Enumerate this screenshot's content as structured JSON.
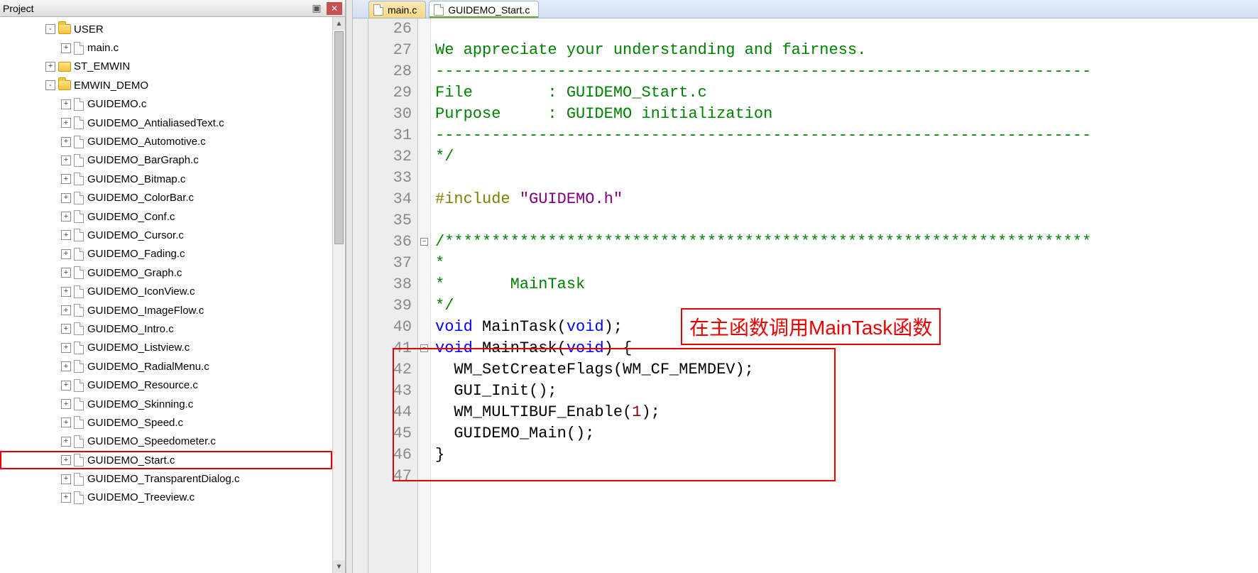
{
  "project_panel": {
    "title": "Project",
    "tree": [
      {
        "depth": 2,
        "exp": "-",
        "kind": "folder-open",
        "label": "USER"
      },
      {
        "depth": 3,
        "exp": "+",
        "kind": "file",
        "label": "main.c"
      },
      {
        "depth": 2,
        "exp": "+",
        "kind": "folder",
        "label": "ST_EMWIN"
      },
      {
        "depth": 2,
        "exp": "-",
        "kind": "folder-open",
        "label": "EMWIN_DEMO"
      },
      {
        "depth": 3,
        "exp": "+",
        "kind": "file",
        "label": "GUIDEMO.c"
      },
      {
        "depth": 3,
        "exp": "+",
        "kind": "file",
        "label": "GUIDEMO_AntialiasedText.c"
      },
      {
        "depth": 3,
        "exp": "+",
        "kind": "file",
        "label": "GUIDEMO_Automotive.c"
      },
      {
        "depth": 3,
        "exp": "+",
        "kind": "file",
        "label": "GUIDEMO_BarGraph.c"
      },
      {
        "depth": 3,
        "exp": "+",
        "kind": "file",
        "label": "GUIDEMO_Bitmap.c"
      },
      {
        "depth": 3,
        "exp": "+",
        "kind": "file",
        "label": "GUIDEMO_ColorBar.c"
      },
      {
        "depth": 3,
        "exp": "+",
        "kind": "file",
        "label": "GUIDEMO_Conf.c"
      },
      {
        "depth": 3,
        "exp": "+",
        "kind": "file",
        "label": "GUIDEMO_Cursor.c"
      },
      {
        "depth": 3,
        "exp": "+",
        "kind": "file",
        "label": "GUIDEMO_Fading.c"
      },
      {
        "depth": 3,
        "exp": "+",
        "kind": "file",
        "label": "GUIDEMO_Graph.c"
      },
      {
        "depth": 3,
        "exp": "+",
        "kind": "file",
        "label": "GUIDEMO_IconView.c"
      },
      {
        "depth": 3,
        "exp": "+",
        "kind": "file",
        "label": "GUIDEMO_ImageFlow.c"
      },
      {
        "depth": 3,
        "exp": "+",
        "kind": "file",
        "label": "GUIDEMO_Intro.c"
      },
      {
        "depth": 3,
        "exp": "+",
        "kind": "file",
        "label": "GUIDEMO_Listview.c"
      },
      {
        "depth": 3,
        "exp": "+",
        "kind": "file",
        "label": "GUIDEMO_RadialMenu.c"
      },
      {
        "depth": 3,
        "exp": "+",
        "kind": "file",
        "label": "GUIDEMO_Resource.c"
      },
      {
        "depth": 3,
        "exp": "+",
        "kind": "file",
        "label": "GUIDEMO_Skinning.c"
      },
      {
        "depth": 3,
        "exp": "+",
        "kind": "file",
        "label": "GUIDEMO_Speed.c"
      },
      {
        "depth": 3,
        "exp": "+",
        "kind": "file",
        "label": "GUIDEMO_Speedometer.c"
      },
      {
        "depth": 3,
        "exp": "+",
        "kind": "file",
        "label": "GUIDEMO_Start.c",
        "highlight": true
      },
      {
        "depth": 3,
        "exp": "+",
        "kind": "file",
        "label": "GUIDEMO_TransparentDialog.c"
      },
      {
        "depth": 3,
        "exp": "+",
        "kind": "file",
        "label": "GUIDEMO_Treeview.c"
      }
    ]
  },
  "editor": {
    "tabs": [
      {
        "label": "main.c",
        "active": false
      },
      {
        "label": "GUIDEMO_Start.c",
        "active": true
      }
    ],
    "first_line_no": 26,
    "lines": [
      {
        "fold": "",
        "tokens": []
      },
      {
        "fold": "",
        "tokens": [
          {
            "cls": "c-comment",
            "t": "We appreciate your understanding and fairness."
          }
        ]
      },
      {
        "fold": "",
        "tokens": [
          {
            "cls": "c-comment",
            "t": "----------------------------------------------------------------------"
          }
        ]
      },
      {
        "fold": "",
        "tokens": [
          {
            "cls": "c-comment",
            "t": "File        : GUIDEMO_Start.c"
          }
        ]
      },
      {
        "fold": "",
        "tokens": [
          {
            "cls": "c-comment",
            "t": "Purpose     : GUIDEMO initialization"
          }
        ]
      },
      {
        "fold": "",
        "tokens": [
          {
            "cls": "c-comment",
            "t": "----------------------------------------------------------------------"
          }
        ]
      },
      {
        "fold": "",
        "tokens": [
          {
            "cls": "c-comment",
            "t": "*/"
          }
        ]
      },
      {
        "fold": "",
        "tokens": []
      },
      {
        "fold": "",
        "tokens": [
          {
            "cls": "c-pp",
            "t": "#include "
          },
          {
            "cls": "c-str",
            "t": "\"GUIDEMO.h\""
          }
        ]
      },
      {
        "fold": "",
        "tokens": []
      },
      {
        "fold": "-",
        "tokens": [
          {
            "cls": "c-comment",
            "t": "/*********************************************************************"
          }
        ]
      },
      {
        "fold": "",
        "tokens": [
          {
            "cls": "c-comment",
            "t": "*"
          }
        ]
      },
      {
        "fold": "",
        "tokens": [
          {
            "cls": "c-comment",
            "t": "*       MainTask"
          }
        ]
      },
      {
        "fold": "",
        "tokens": [
          {
            "cls": "c-comment",
            "t": "*/"
          }
        ]
      },
      {
        "fold": "",
        "tokens": [
          {
            "cls": "c-keyword",
            "t": "void"
          },
          {
            "cls": "c-ident",
            "t": " MainTask("
          },
          {
            "cls": "c-keyword",
            "t": "void"
          },
          {
            "cls": "c-ident",
            "t": ");"
          }
        ]
      },
      {
        "fold": "-",
        "tokens": [
          {
            "cls": "c-keyword",
            "t": "void"
          },
          {
            "cls": "c-ident",
            "t": " MainTask("
          },
          {
            "cls": "c-keyword",
            "t": "void"
          },
          {
            "cls": "c-ident",
            "t": ") {"
          }
        ]
      },
      {
        "fold": "",
        "tokens": [
          {
            "cls": "c-ident",
            "t": "  WM_SetCreateFlags(WM_CF_MEMDEV);"
          }
        ]
      },
      {
        "fold": "",
        "tokens": [
          {
            "cls": "c-ident",
            "t": "  GUI_Init();"
          }
        ]
      },
      {
        "fold": "",
        "tokens": [
          {
            "cls": "c-ident",
            "t": "  WM_MULTIBUF_Enable("
          },
          {
            "cls": "c-num",
            "t": "1"
          },
          {
            "cls": "c-ident",
            "t": ");"
          }
        ]
      },
      {
        "fold": "",
        "tokens": [
          {
            "cls": "c-ident",
            "t": "  GUIDEMO_Main();"
          }
        ]
      },
      {
        "fold": "",
        "tokens": [
          {
            "cls": "c-ident",
            "t": "}"
          }
        ]
      },
      {
        "fold": "",
        "tokens": []
      }
    ],
    "annotation_text": "在主函数调用MainTask函数"
  }
}
